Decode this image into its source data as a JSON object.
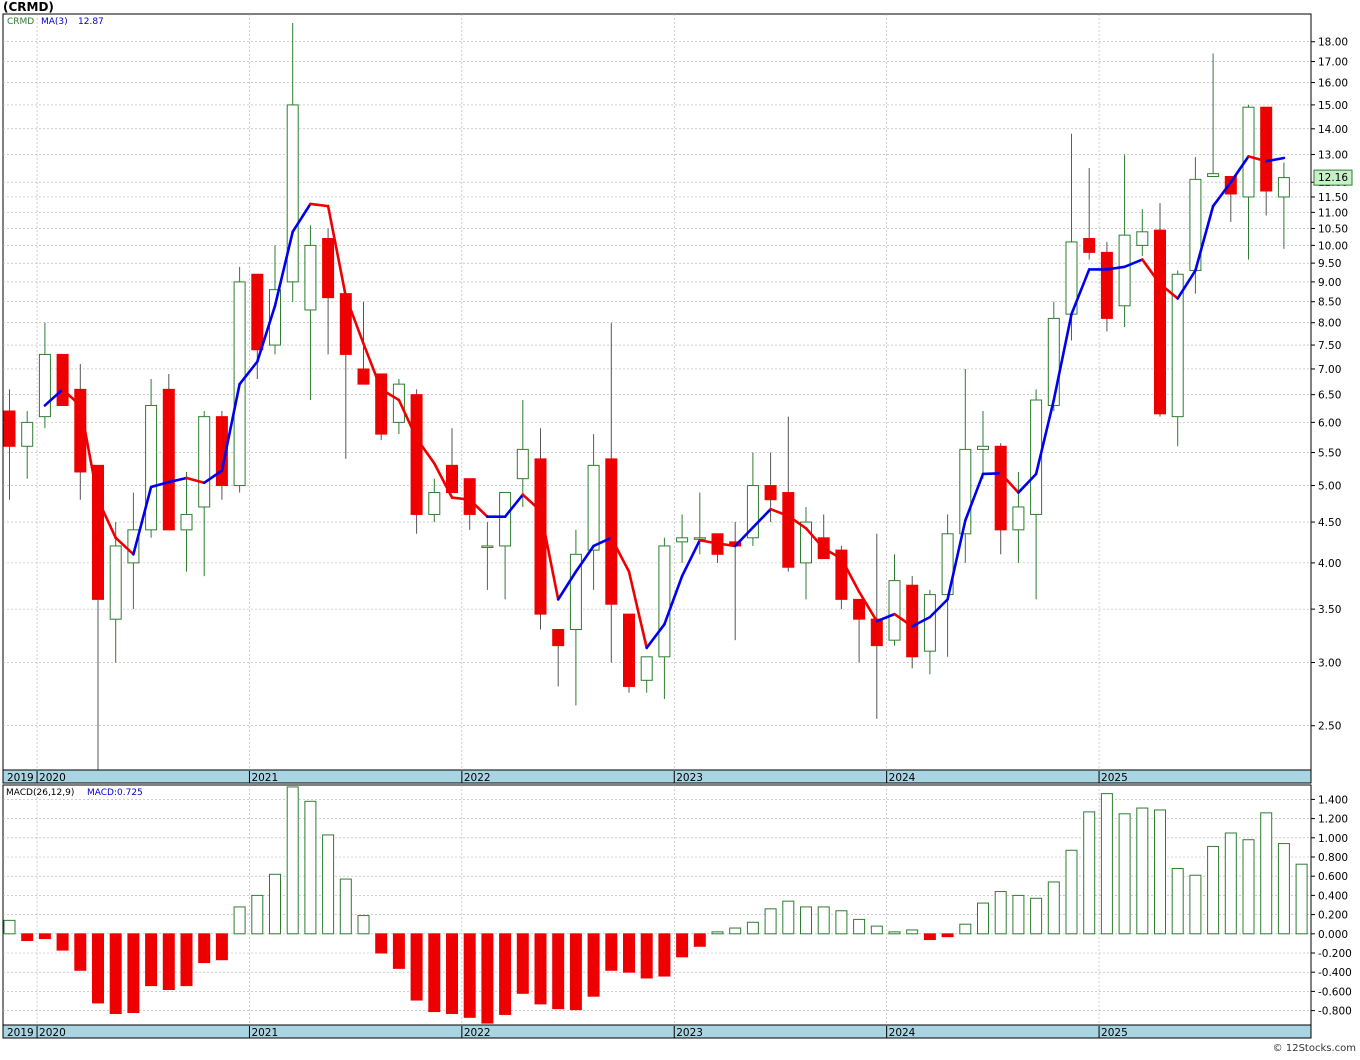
{
  "title": "(CRMD)",
  "watermark": "© 12Stocks.com",
  "price_panel": {
    "ticker_label": "CRMD",
    "ma_label": "MA(3)",
    "ma_value": "12.87",
    "last_price": "12.16"
  },
  "macd_panel": {
    "label": "MACD(26,12,9)",
    "value_label": "MACD:0.725"
  },
  "x_axis_labels": [
    "2019",
    "2020",
    "2021",
    "2022",
    "2023",
    "2024",
    "2025"
  ],
  "colors": {
    "up_candle": "#2e7d32",
    "down_candle": "#ee0000",
    "ma_rising": "#0000ee",
    "ma_falling": "#ee0000",
    "axis_band": "#a9d5e3",
    "grid": "#b0b0b0",
    "last_price_box": "#c8f0c8"
  },
  "chart_data": [
    {
      "type": "candlestick",
      "title": "(CRMD)",
      "scale": "log",
      "ylim": [
        2.2,
        19.5
      ],
      "y_ticks": [
        2.5,
        3.0,
        3.5,
        4.0,
        4.5,
        5.0,
        5.5,
        6.0,
        6.5,
        7.0,
        7.5,
        8.0,
        8.5,
        9.0,
        9.5,
        10.0,
        10.5,
        11.0,
        11.5,
        12.0,
        13.0,
        14.0,
        15.0,
        16.0,
        17.0,
        18.0
      ],
      "y_tick_labels": [
        "2.50",
        "3.00",
        "3.50",
        "4.00",
        "4.50",
        "5.00",
        "5.50",
        "6.00",
        "6.50",
        "7.00",
        "7.50",
        "8.00",
        "8.50",
        "9.00",
        "9.50",
        "10.00",
        "10.50",
        "11.00",
        "11.50",
        "12.00",
        "13.00",
        "14.00",
        "15.00",
        "16.00",
        "17.00",
        "18.00"
      ],
      "x_first_month": "2019-11",
      "series": [
        {
          "name": "CRMD",
          "ohlc": [
            [
              6.2,
              6.6,
              4.8,
              5.6
            ],
            [
              5.6,
              6.2,
              5.1,
              6.0
            ],
            [
              6.1,
              8.0,
              5.9,
              7.3
            ],
            [
              7.3,
              7.3,
              6.3,
              6.3
            ],
            [
              6.6,
              7.1,
              4.8,
              5.2
            ],
            [
              5.3,
              5.3,
              2.2,
              3.6
            ],
            [
              3.4,
              4.5,
              3.0,
              4.2
            ],
            [
              4.0,
              4.9,
              3.5,
              4.4
            ],
            [
              4.4,
              6.8,
              4.3,
              6.3
            ],
            [
              6.6,
              6.9,
              4.4,
              4.4
            ],
            [
              4.4,
              5.2,
              3.9,
              4.6
            ],
            [
              4.7,
              6.2,
              3.85,
              6.1
            ],
            [
              6.1,
              6.2,
              4.8,
              5.0
            ],
            [
              5.0,
              9.4,
              4.9,
              9.0
            ],
            [
              9.2,
              9.2,
              6.8,
              7.4
            ],
            [
              7.5,
              10.0,
              7.3,
              8.8
            ],
            [
              9.0,
              19.0,
              8.5,
              15.0
            ],
            [
              8.3,
              10.6,
              6.4,
              10.0
            ],
            [
              10.2,
              10.5,
              7.3,
              8.6
            ],
            [
              8.7,
              8.7,
              5.4,
              7.3
            ],
            [
              7.0,
              8.5,
              6.7,
              6.7
            ],
            [
              6.9,
              6.9,
              5.7,
              5.8
            ],
            [
              6.0,
              6.8,
              5.8,
              6.7
            ],
            [
              6.5,
              6.6,
              4.35,
              4.6
            ],
            [
              4.6,
              5.1,
              4.5,
              4.9
            ],
            [
              5.3,
              5.9,
              4.9,
              4.9
            ],
            [
              5.1,
              5.1,
              4.4,
              4.6
            ],
            [
              4.2,
              4.5,
              3.7,
              4.2
            ],
            [
              4.2,
              4.9,
              3.6,
              4.9
            ],
            [
              5.1,
              6.4,
              4.7,
              5.55
            ],
            [
              5.4,
              5.9,
              3.3,
              3.45
            ],
            [
              3.3,
              3.3,
              2.8,
              3.15
            ],
            [
              3.3,
              4.4,
              2.65,
              4.1
            ],
            [
              4.15,
              5.8,
              3.7,
              5.3
            ],
            [
              5.4,
              8.0,
              3.0,
              3.55
            ],
            [
              3.45,
              3.45,
              2.75,
              2.8
            ],
            [
              2.85,
              3.05,
              2.75,
              3.05
            ],
            [
              3.05,
              4.3,
              2.7,
              4.2
            ],
            [
              4.25,
              4.6,
              4.0,
              4.3
            ],
            [
              4.3,
              4.9,
              4.1,
              4.3
            ],
            [
              4.35,
              4.35,
              4.0,
              4.1
            ],
            [
              4.25,
              4.5,
              3.2,
              4.2
            ],
            [
              4.3,
              5.5,
              4.2,
              5.0
            ],
            [
              5.0,
              5.5,
              4.5,
              4.8
            ],
            [
              4.9,
              6.1,
              3.9,
              3.95
            ],
            [
              4.0,
              4.7,
              3.6,
              4.5
            ],
            [
              4.3,
              4.6,
              4.05,
              4.05
            ],
            [
              4.15,
              4.2,
              3.5,
              3.6
            ],
            [
              3.6,
              3.6,
              3.0,
              3.4
            ],
            [
              3.4,
              4.35,
              2.55,
              3.15
            ],
            [
              3.2,
              4.1,
              3.15,
              3.8
            ],
            [
              3.75,
              3.85,
              2.95,
              3.05
            ],
            [
              3.1,
              3.7,
              2.9,
              3.65
            ],
            [
              3.65,
              4.6,
              3.05,
              4.35
            ],
            [
              4.35,
              7.0,
              4.0,
              5.55
            ],
            [
              5.55,
              6.2,
              5.1,
              5.6
            ],
            [
              5.6,
              5.65,
              4.1,
              4.4
            ],
            [
              4.4,
              5.2,
              4.0,
              4.7
            ],
            [
              4.6,
              6.6,
              3.6,
              6.4
            ],
            [
              6.3,
              8.5,
              6.2,
              8.1
            ],
            [
              8.2,
              13.8,
              7.6,
              10.1
            ],
            [
              10.2,
              12.5,
              9.6,
              9.8
            ],
            [
              9.8,
              10.1,
              7.8,
              8.1
            ],
            [
              8.4,
              13.0,
              7.9,
              10.3
            ],
            [
              10.0,
              11.1,
              9.7,
              10.4
            ],
            [
              10.45,
              11.3,
              6.1,
              6.15
            ],
            [
              6.1,
              9.3,
              5.6,
              9.2
            ],
            [
              9.3,
              12.9,
              8.7,
              12.1
            ],
            [
              12.2,
              17.4,
              12.2,
              12.3
            ],
            [
              12.2,
              12.2,
              10.7,
              11.6
            ],
            [
              11.5,
              15.0,
              9.6,
              14.9
            ],
            [
              14.9,
              14.9,
              10.9,
              11.7
            ],
            [
              11.5,
              12.7,
              9.9,
              12.16
            ]
          ]
        },
        {
          "name": "MA(3)",
          "values": [
            null,
            null,
            6.3,
            6.6,
            6.3,
            4.8,
            4.3,
            4.1,
            4.98,
            5.05,
            5.11,
            5.04,
            5.22,
            6.7,
            7.15,
            8.4,
            10.4,
            11.27,
            11.2,
            8.63,
            7.53,
            6.6,
            6.4,
            5.73,
            5.33,
            4.83,
            4.8,
            4.57,
            4.57,
            4.87,
            4.65,
            3.6,
            3.9,
            4.2,
            4.3,
            3.9,
            3.13,
            3.35,
            3.85,
            4.27,
            4.23,
            4.2,
            4.43,
            4.67,
            4.58,
            4.42,
            4.17,
            4.05,
            3.68,
            3.38,
            3.45,
            3.33,
            3.42,
            3.6,
            4.52,
            5.17,
            5.18,
            4.9,
            5.17,
            6.4,
            8.2,
            9.33,
            9.33,
            9.4,
            9.6,
            8.95,
            8.58,
            9.3,
            11.2,
            12.0,
            12.93,
            12.75,
            12.87
          ]
        }
      ]
    },
    {
      "type": "bar",
      "title": "MACD(26,12,9)",
      "ylim": [
        -0.95,
        1.55
      ],
      "y_ticks": [
        -0.8,
        -0.6,
        -0.4,
        -0.2,
        0.0,
        0.2,
        0.4,
        0.6,
        0.8,
        1.0,
        1.2,
        1.4
      ],
      "y_tick_labels": [
        "-0.800",
        "-0.600",
        "-0.400",
        "-0.200",
        "0.000",
        "0.200",
        "0.400",
        "0.600",
        "0.800",
        "1.000",
        "1.200",
        "1.400"
      ],
      "series": [
        {
          "name": "MACD",
          "values": [
            0.14,
            -0.07,
            -0.05,
            -0.17,
            -0.38,
            -0.72,
            -0.83,
            -0.82,
            -0.54,
            -0.58,
            -0.54,
            -0.3,
            -0.27,
            0.28,
            0.4,
            0.62,
            1.53,
            1.38,
            1.03,
            0.57,
            0.19,
            -0.2,
            -0.36,
            -0.69,
            -0.81,
            -0.83,
            -0.87,
            -0.93,
            -0.84,
            -0.62,
            -0.73,
            -0.78,
            -0.79,
            -0.65,
            -0.38,
            -0.4,
            -0.46,
            -0.44,
            -0.24,
            -0.13,
            0.02,
            0.06,
            0.12,
            0.26,
            0.34,
            0.28,
            0.28,
            0.24,
            0.15,
            0.08,
            0.02,
            0.04,
            -0.06,
            -0.03,
            0.1,
            0.32,
            0.44,
            0.4,
            0.37,
            0.54,
            0.87,
            1.27,
            1.46,
            1.25,
            1.31,
            1.29,
            0.68,
            0.61,
            0.91,
            1.05,
            0.98,
            1.26,
            0.94,
            0.725
          ]
        }
      ]
    }
  ]
}
